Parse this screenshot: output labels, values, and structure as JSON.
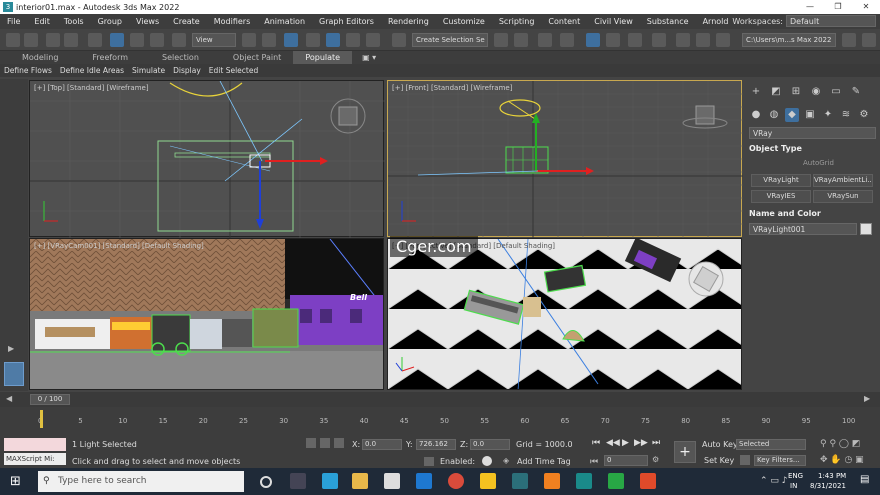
{
  "window": {
    "title": "interior01.max - Autodesk 3ds Max 2022",
    "min": "—",
    "max": "❐",
    "close": "✕"
  },
  "menu": [
    "File",
    "Edit",
    "Tools",
    "Group",
    "Views",
    "Create",
    "Modifiers",
    "Animation",
    "Graph Editors",
    "Rendering",
    "Customize",
    "Scripting",
    "Content",
    "Civil View",
    "Substance",
    "Arnold"
  ],
  "workspaces": {
    "label": "Workspaces:",
    "value": "Default"
  },
  "toolbar": {
    "ref_coord": "View",
    "selection_set": "Create Selection Se",
    "project_path": "C:\\Users\\m...s Max 2022"
  },
  "ribbon": {
    "tabs": [
      "Modeling",
      "Freeform",
      "Selection",
      "Object Paint",
      "Populate"
    ]
  },
  "subribbon": [
    "Define Flows",
    "Define Idle Areas",
    "Simulate",
    "Display",
    "Edit Selected"
  ],
  "viewports": {
    "top": "[+] [Top] [Standard] [Wireframe]",
    "front": "[+] [Front] [Standard] [Wireframe]",
    "camera": "[+] [VRayCam001] [Standard] [Default Shading]",
    "persp": "[+] [Perspective] [Standard] [Default Shading]",
    "cam_sign": "Bell"
  },
  "command_panel": {
    "category": "VRay",
    "object_type": "Object Type",
    "autogrid": "AutoGrid",
    "buttons": [
      "VRayLight",
      "VRayAmbientLi...",
      "VRayIES",
      "VRaySun"
    ],
    "name_color": "Name and Color",
    "name_value": "VRayLight001",
    "swatch": "#e0e0e0"
  },
  "timeline": {
    "frame": "0 / 100",
    "ticks": [
      "0",
      "5",
      "10",
      "15",
      "20",
      "25",
      "30",
      "35",
      "40",
      "45",
      "50",
      "55",
      "60",
      "65",
      "70",
      "75",
      "80",
      "85",
      "90",
      "95",
      "100"
    ]
  },
  "status": {
    "maxscript": "MAXScript Mi:",
    "selected": "1 Light Selected",
    "prompt": "Click and drag to select and move objects",
    "x_label": "X:",
    "x": "0.0",
    "y_label": "Y:",
    "y": "726.162",
    "z_label": "Z:",
    "z": "0.0",
    "grid": "Grid = 1000.0",
    "enabled": "Enabled:",
    "add_time_tag": "Add Time Tag",
    "auto_key": "Auto Key",
    "auto_key_value": "Selected",
    "set_key": "Set Key",
    "key_filters": "Key Filters...",
    "frame_field": "0"
  },
  "taskbar": {
    "search": "Type here to search",
    "lang": "ENG",
    "region": "IN",
    "time": "1:43 PM",
    "date": "8/31/2021"
  },
  "watermark": "Cger.com",
  "colors": {
    "accent": "#3e6f9e",
    "panel": "#444444",
    "selected_wire": "#4ddc4d"
  }
}
